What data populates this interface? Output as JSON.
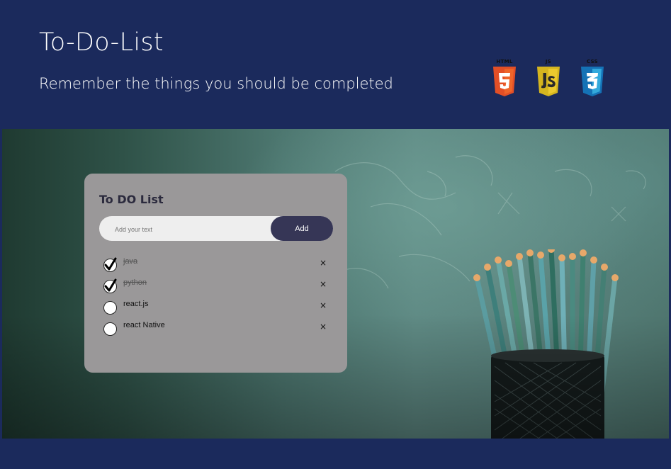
{
  "header": {
    "title": "To-Do-List",
    "subtitle": "Remember the things you should be completed"
  },
  "badges": [
    {
      "label": "HTML",
      "icon": "html5-icon",
      "color": "#e34f26",
      "glyph": "5"
    },
    {
      "label": "JS",
      "icon": "js-icon",
      "color": "#e8c32d",
      "glyph": "JS"
    },
    {
      "label": "CSS",
      "icon": "css3-icon",
      "color": "#2965f1",
      "glyph": "3"
    }
  ],
  "todo": {
    "title": "To DO List",
    "input_placeholder": "Add your text",
    "input_value": "",
    "add_label": "Add",
    "delete_glyph": "×",
    "tasks": [
      {
        "text": "java",
        "done": true
      },
      {
        "text": "python",
        "done": true
      },
      {
        "text": "react.js",
        "done": false
      },
      {
        "text": "react Native",
        "done": false
      }
    ]
  },
  "colors": {
    "page_background": "#1b2a5c",
    "card_background": "#9a9899",
    "add_button": "#363656"
  }
}
